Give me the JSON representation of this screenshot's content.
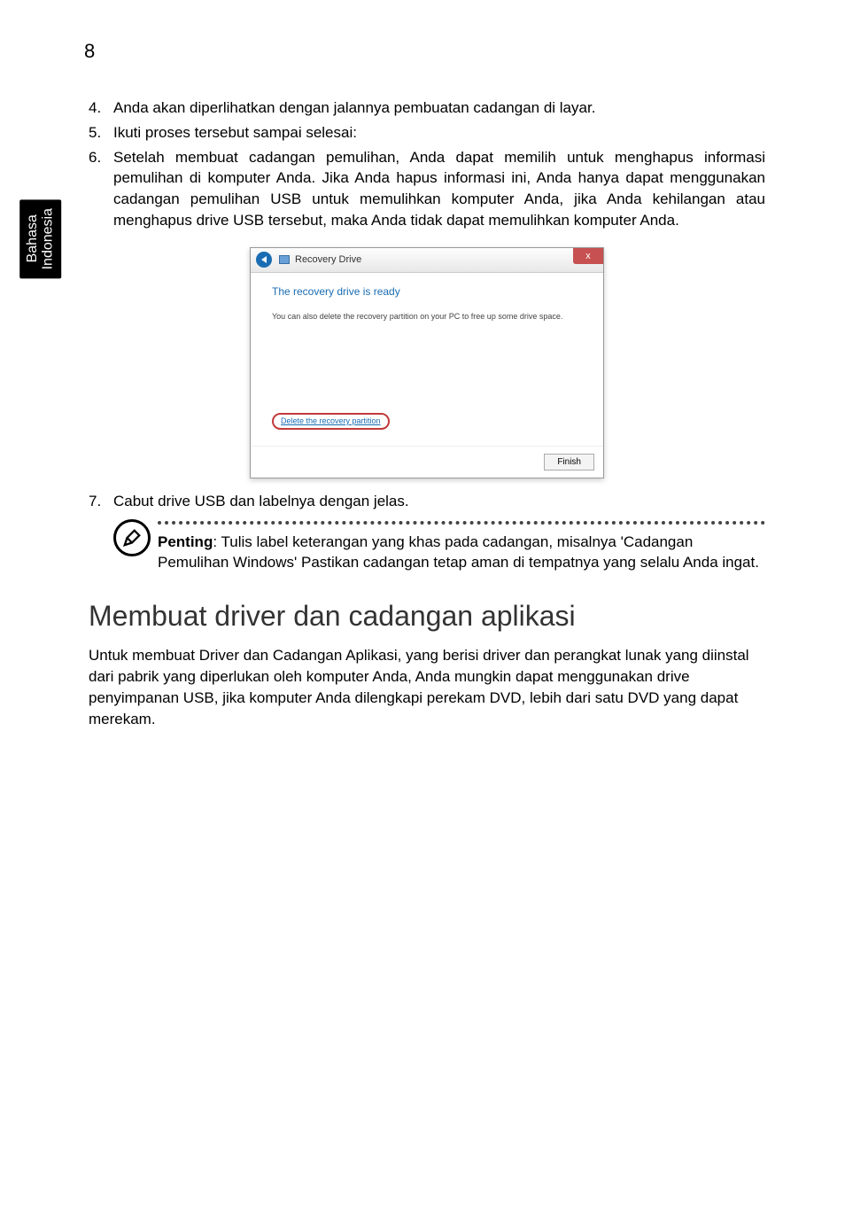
{
  "page_number": "8",
  "side_tab": "Bahasa\nIndonesia",
  "list": {
    "item4": {
      "num": "4.",
      "text": "Anda akan diperlihatkan dengan jalannya pembuatan cadangan di layar."
    },
    "item5": {
      "num": "5.",
      "text": "Ikuti proses tersebut sampai selesai:"
    },
    "item6": {
      "num": "6.",
      "text": "Setelah membuat cadangan pemulihan, Anda dapat memilih untuk menghapus informasi pemulihan di komputer Anda. Jika Anda hapus informasi ini, Anda hanya dapat menggunakan cadangan pemulihan USB untuk memulihkan komputer Anda, jika Anda kehilangan atau menghapus drive USB tersebut, maka Anda tidak dapat memulihkan komputer Anda."
    },
    "item7": {
      "num": "7.",
      "text": "Cabut drive USB dan labelnya dengan jelas."
    }
  },
  "screenshot": {
    "title": "Recovery Drive",
    "close": "x",
    "heading": "The recovery drive is ready",
    "body_text": "You can also delete the recovery partition on your PC to free up some drive space.",
    "link": "Delete the recovery partition",
    "finish": "Finish"
  },
  "note": {
    "label": "Penting",
    "text": ": Tulis label keterangan yang khas pada cadangan, misalnya 'Cadangan Pemulihan Windows' Pastikan cadangan tetap aman di tempatnya yang selalu Anda ingat."
  },
  "section": {
    "heading": "Membuat driver dan cadangan aplikasi",
    "para": "Untuk membuat Driver dan Cadangan Aplikasi, yang berisi driver dan perangkat lunak yang diinstal dari pabrik yang diperlukan oleh komputer Anda, Anda mungkin dapat menggunakan drive penyimpanan USB, jika komputer Anda dilengkapi perekam DVD, lebih dari satu DVD yang dapat merekam."
  }
}
